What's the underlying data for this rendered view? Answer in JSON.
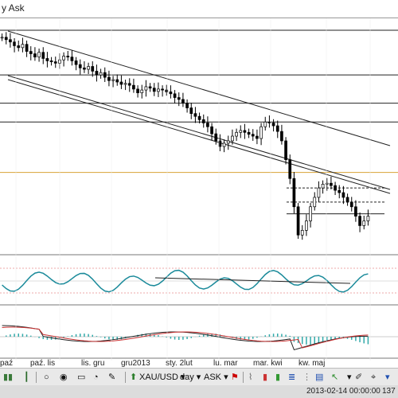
{
  "window": {
    "title": "y Ask"
  },
  "chart_data": {
    "type": "candlestick",
    "symbol": "XAU/USD",
    "timeframe": "day",
    "price_side": "ASK",
    "x_labels": [
      "paź",
      "paź",
      "lis",
      "lis",
      "gru",
      "gru",
      "gru2013",
      "sty",
      "sty",
      "2lut",
      "lut",
      "mar",
      "mar",
      "kwi",
      "kwi",
      "maj",
      "maj"
    ],
    "x_tick_text": [
      "paź",
      "paź. lis",
      "lis. gru",
      "gru2013",
      "sty. 2lut",
      "lu. mar",
      "mar. kwi",
      "kw. maj"
    ],
    "closes": [
      1780,
      1775,
      1770,
      1762,
      1758,
      1765,
      1750,
      1745,
      1738,
      1748,
      1735,
      1730,
      1728,
      1725,
      1732,
      1740,
      1738,
      1730,
      1722,
      1715,
      1712,
      1718,
      1708,
      1700,
      1705,
      1695,
      1688,
      1690,
      1685,
      1680,
      1682,
      1678,
      1670,
      1662,
      1668,
      1675,
      1672,
      1665,
      1670,
      1668,
      1664,
      1660,
      1652,
      1648,
      1640,
      1630,
      1618,
      1612,
      1605,
      1598,
      1590,
      1575,
      1560,
      1548,
      1555,
      1560,
      1570,
      1578,
      1582,
      1578,
      1574,
      1570,
      1565,
      1590,
      1600,
      1598,
      1592,
      1580,
      1560,
      1520,
      1480,
      1420,
      1360,
      1370,
      1390,
      1420,
      1440,
      1460,
      1468,
      1470,
      1465,
      1455,
      1450,
      1440,
      1430,
      1420,
      1400,
      1380,
      1390,
      1400
    ],
    "rsi_description": "oscillator panel",
    "macd_description": "histogram with two lines"
  },
  "toolbar": {
    "symbol": "XAU/USD",
    "timeframe": "day",
    "side": "ASK"
  },
  "status": {
    "datetime": "2013-02-14 00:00:00",
    "price_partial": "137"
  }
}
